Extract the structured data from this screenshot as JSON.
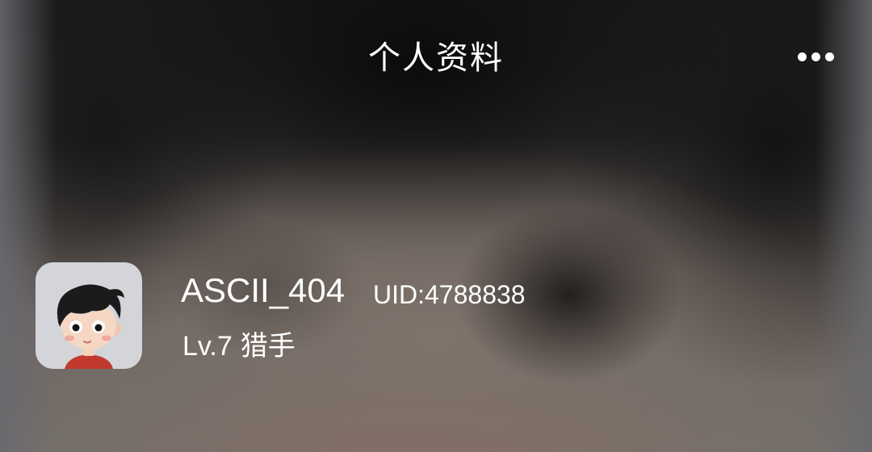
{
  "header": {
    "title": "个人资料",
    "more_icon": "more-horizontal-icon"
  },
  "profile": {
    "avatar_icon": "cartoon-boy-avatar",
    "username": "ASCII_404",
    "uid": "UID:4788838",
    "level": "Lv.7",
    "rank": "猎手"
  },
  "colors": {
    "text": "#ffffff",
    "avatar_bg": "#d3d5d9"
  }
}
